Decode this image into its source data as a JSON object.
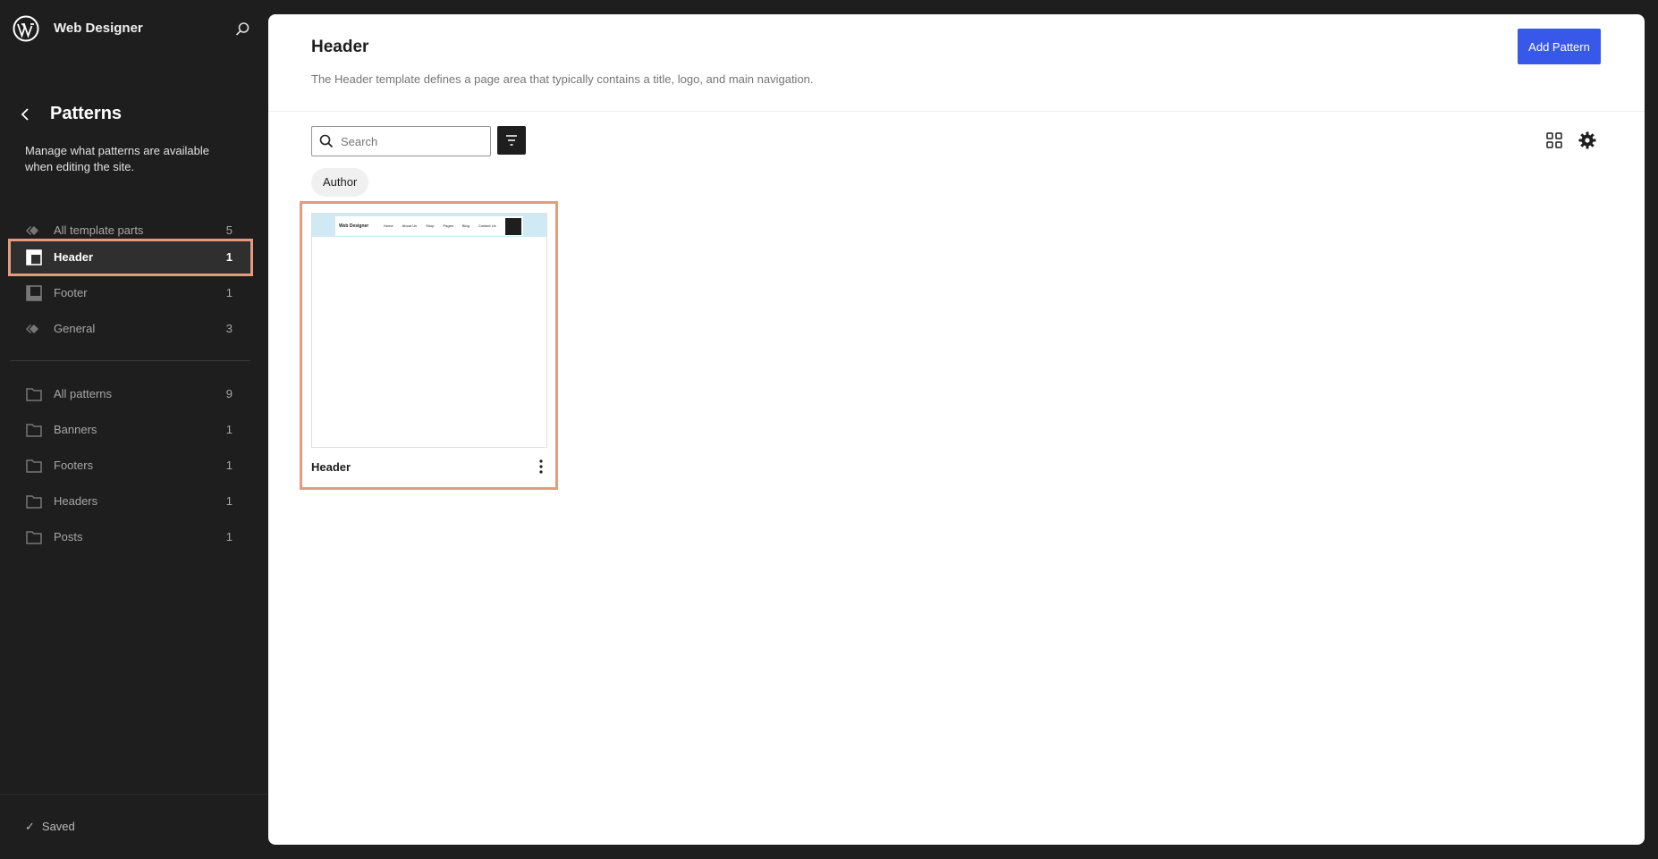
{
  "topbar": {
    "site_name": "Web Designer"
  },
  "sidebar": {
    "title": "Patterns",
    "description": "Manage what patterns are available when editing the site.",
    "template_parts": [
      {
        "label": "All template parts",
        "count": "5",
        "icon": "diamonds-icon",
        "active": false
      },
      {
        "label": "Header",
        "count": "1",
        "icon": "header-layout-icon",
        "active": true
      },
      {
        "label": "Footer",
        "count": "1",
        "icon": "footer-layout-icon",
        "active": false
      },
      {
        "label": "General",
        "count": "3",
        "icon": "diamonds-icon",
        "active": false
      }
    ],
    "pattern_categories": [
      {
        "label": "All patterns",
        "count": "9",
        "icon": "folder-icon"
      },
      {
        "label": "Banners",
        "count": "1",
        "icon": "folder-icon"
      },
      {
        "label": "Footers",
        "count": "1",
        "icon": "folder-icon"
      },
      {
        "label": "Headers",
        "count": "1",
        "icon": "folder-icon"
      },
      {
        "label": "Posts",
        "count": "1",
        "icon": "folder-icon"
      }
    ],
    "status": "Saved"
  },
  "main": {
    "title": "Header",
    "description": "The Header template defines a page area that typically contains a title, logo, and main navigation.",
    "add_button": "Add Pattern",
    "search": {
      "placeholder": "Search",
      "value": ""
    },
    "filter_chip": "Author",
    "cards": [
      {
        "title": "Header",
        "preview": {
          "site": "Web Designer",
          "nav": [
            "Home",
            "About Us",
            "Shop",
            "Pages",
            "Blog",
            "Contact Us"
          ]
        }
      }
    ]
  },
  "colors": {
    "accent": "#3858e9",
    "highlight": "#e59b7c",
    "sidebar_bg": "#1e1e1e"
  }
}
